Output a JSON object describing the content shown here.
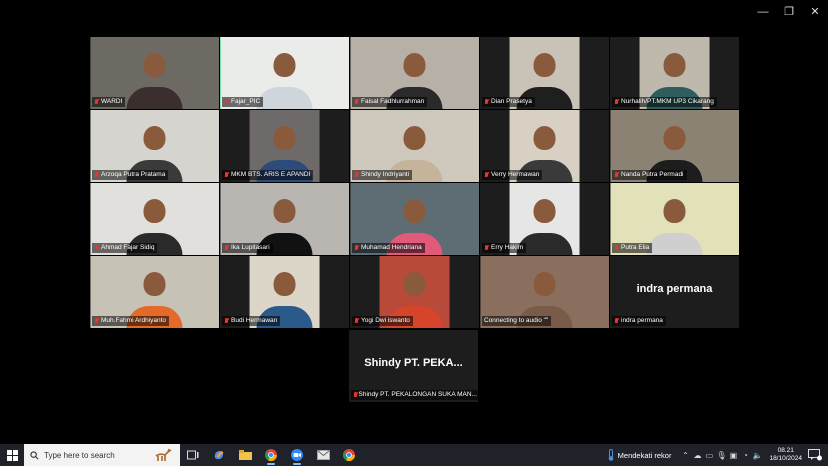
{
  "window": {
    "minimize": "—",
    "maximize": "❐",
    "close": "✕"
  },
  "participants": [
    {
      "name": "WARDI",
      "bg": "#6d6a64",
      "shirt": "#3b2e2e",
      "narrow": false
    },
    {
      "name": "Fajar_PIC",
      "bg": "#e9ece9",
      "shirt": "#cfd6db",
      "narrow": false,
      "active": true
    },
    {
      "name": "Faisal Fadhlurrahman",
      "bg": "#b7b0a6",
      "shirt": "#2a2a2a",
      "narrow": false
    },
    {
      "name": "Dian Prasetya",
      "bg": "#c8c3b6",
      "shirt": "#1f1f1f",
      "narrow": true
    },
    {
      "name": "Nurhalih/PT.MKM UP3 Cikarang",
      "bg": "#bfb9ad",
      "shirt": "#2f5d5d",
      "narrow": true
    },
    {
      "name": "Arzoqa Putra Pratama",
      "bg": "#d6d4cf",
      "shirt": "#3a3a3a",
      "narrow": false
    },
    {
      "name": "MKM BTS. ARIS E APANDI",
      "bg": "#6f6a6a",
      "shirt": "#2c4a7a",
      "narrow": true
    },
    {
      "name": "Shindy Indriyanti",
      "bg": "#cfc8bd",
      "shirt": "#c6b49a",
      "narrow": false
    },
    {
      "name": "Verry Hermawan",
      "bg": "#d7d0c3",
      "shirt": "#3a3a3a",
      "narrow": true
    },
    {
      "name": "Nanda Putra Permadi",
      "bg": "#8b8274",
      "shirt": "#1d1d1d",
      "narrow": false
    },
    {
      "name": "Ahmad Fajar Sidiq",
      "bg": "#e2e0dc",
      "shirt": "#2a2a2a",
      "narrow": false
    },
    {
      "name": "Ika Lupitasari",
      "bg": "#b9b6b2",
      "shirt": "#111111",
      "narrow": false
    },
    {
      "name": "Muhamad Hendriana",
      "bg": "#5e6d73",
      "shirt": "#e25a7a",
      "narrow": false
    },
    {
      "name": "Erry Hakim",
      "bg": "#e6e6e6",
      "shirt": "#2a2a2a",
      "narrow": true
    },
    {
      "name": "Putra Elia",
      "bg": "#e3e1b9",
      "shirt": "#cfcfcf",
      "narrow": false
    },
    {
      "name": "Muh.Fahmi Ardhiyanto",
      "bg": "#c7c2b6",
      "shirt": "#e56a2a",
      "narrow": false
    },
    {
      "name": "Budi Hermawan",
      "bg": "#dcd6c9",
      "shirt": "#2b5a8a",
      "narrow": true
    },
    {
      "name": "Yogi Dwi iswanto",
      "bg": "#b94a3a",
      "shirt": "#d6452a",
      "narrow": true
    },
    {
      "name": "Connecting to audio \"\"",
      "bg": "#8a6f5f",
      "shirt": "#7a5a48",
      "narrow": false,
      "noMic": true
    },
    {
      "name": "indra permana",
      "bg": "#1d1d1d",
      "shirt": "",
      "narrow": false,
      "avatarText": "indra permana"
    }
  ],
  "extra": {
    "name": "Shindy PT. PEKALONGAN SUKA MAN...",
    "avatarText": "Shindy PT. PEKA..."
  },
  "taskbar": {
    "search_placeholder": "Type here to search",
    "weather": "Mendekati rekor",
    "time": "08.21",
    "date": "18/10/2024"
  }
}
